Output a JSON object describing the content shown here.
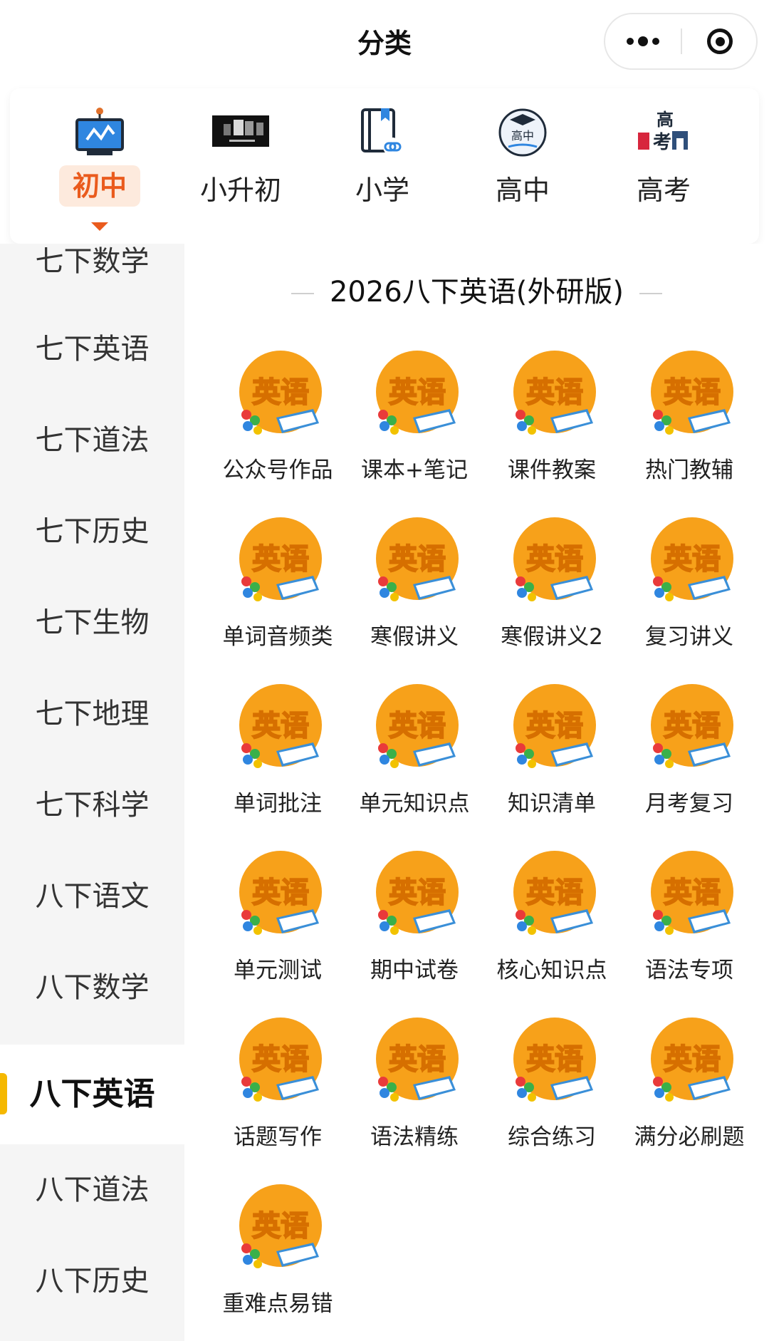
{
  "header": {
    "title": "分类"
  },
  "categories": [
    {
      "label": "初中",
      "icon": "board-icon",
      "active": true
    },
    {
      "label": "小升初",
      "icon": "video-thumbnail-icon",
      "active": false
    },
    {
      "label": "小学",
      "icon": "book-link-icon",
      "active": false
    },
    {
      "label": "高中",
      "icon": "high-school-badge-icon",
      "active": false
    },
    {
      "label": "高考",
      "icon": "gaokao-icon",
      "active": false
    }
  ],
  "category_icon_text": {
    "gaozhong": "高中",
    "gaokao_top": "高",
    "gaokao_bottom": "考"
  },
  "sidebar": {
    "items": [
      {
        "label": "七下数学"
      },
      {
        "label": "七下英语"
      },
      {
        "label": "七下道法"
      },
      {
        "label": "七下历史"
      },
      {
        "label": "七下生物"
      },
      {
        "label": "七下地理"
      },
      {
        "label": "七下科学"
      },
      {
        "label": "八下语文"
      },
      {
        "label": "八下数学"
      },
      {
        "label": "八下英语",
        "active": true
      },
      {
        "label": "八下道法"
      },
      {
        "label": "八下历史"
      }
    ]
  },
  "main": {
    "section_title": "2026八下英语(外研版)",
    "thumb_text": "英语",
    "items": [
      "公众号作品",
      "课本+笔记",
      "课件教案",
      "热门教辅",
      "单词音频类",
      "寒假讲义",
      "寒假讲义2",
      "复习讲义",
      "单词批注",
      "单元知识点",
      "知识清单",
      "月考复习",
      "单元测试",
      "期中试卷",
      "核心知识点",
      "语法专项",
      "话题写作",
      "语法精练",
      "综合练习",
      "满分必刷题",
      "重难点易错"
    ]
  },
  "colors": {
    "accent": "#ea5b1d",
    "highlight": "#f5b800",
    "thumb": "#f7a11a"
  }
}
